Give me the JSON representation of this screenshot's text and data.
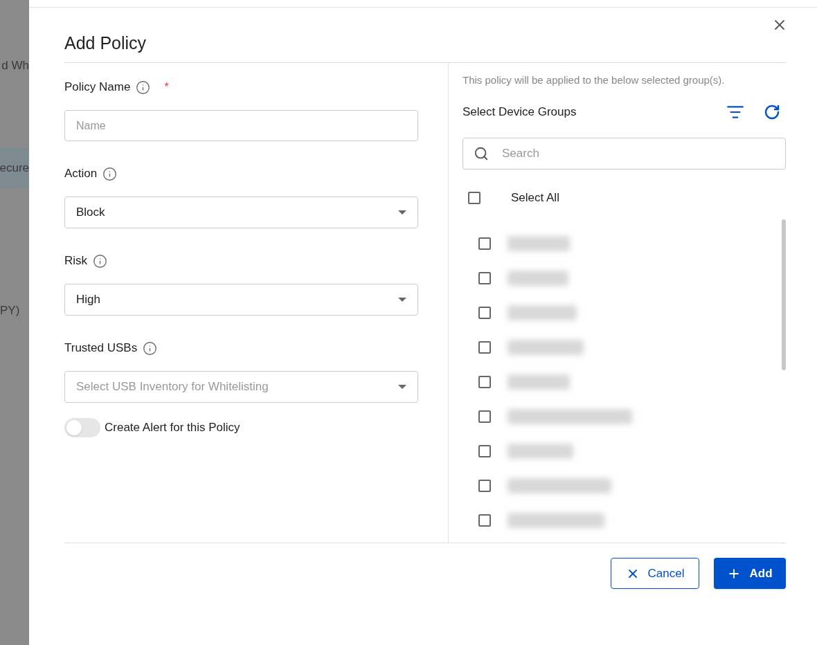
{
  "background": {
    "texts": [
      "d Wh",
      "ecure",
      "PY)"
    ]
  },
  "dialog": {
    "title": "Add Policy",
    "fields": [
      {
        "kind": "text",
        "label": "Policy Name",
        "required_mark": "*",
        "placeholder": "Name"
      },
      {
        "kind": "select",
        "label": "Action",
        "value": "Block"
      },
      {
        "kind": "select",
        "label": "Risk",
        "value": "High"
      },
      {
        "kind": "select",
        "label": "Trusted USBs",
        "placeholder": "Select USB Inventory for Whitelisting"
      }
    ],
    "alert_toggle": {
      "label": "Create Alert for this Policy",
      "on": false
    },
    "groups": {
      "note": "This policy will be applied to the below selected group(s).",
      "title": "Select Device Groups",
      "search": {
        "placeholder": "Search"
      },
      "select_all": {
        "label": "Select All",
        "checked": false
      },
      "items": [
        {
          "checked": false
        },
        {
          "checked": false
        },
        {
          "checked": false
        },
        {
          "checked": false
        },
        {
          "checked": false
        },
        {
          "checked": false
        },
        {
          "checked": false
        },
        {
          "checked": false
        },
        {
          "checked": false
        }
      ]
    },
    "buttons": [
      {
        "kind": "cancel",
        "label": "Cancel"
      },
      {
        "kind": "add",
        "label": "Add"
      }
    ]
  }
}
